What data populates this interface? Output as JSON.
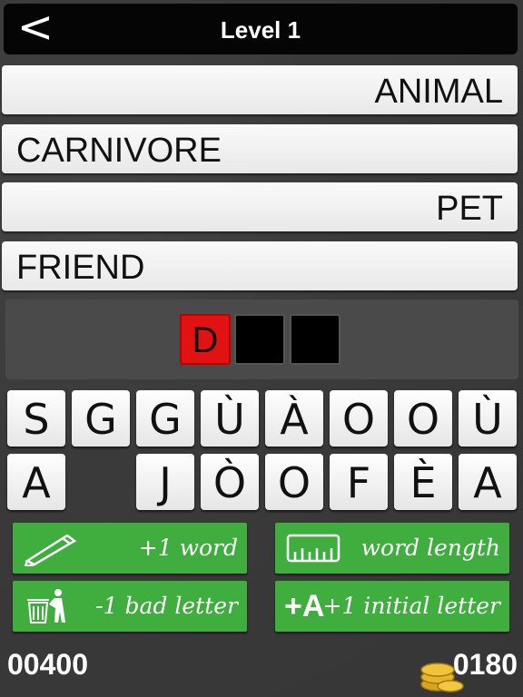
{
  "header": {
    "back_icon": "<",
    "title": "Level 1"
  },
  "clues": [
    "ANIMAL",
    "CARNIVORE",
    "PET",
    "FRIEND"
  ],
  "answer": {
    "slots": [
      "D",
      "",
      ""
    ]
  },
  "letters": {
    "row1": [
      "S",
      "G",
      "G",
      "Ù",
      "À",
      "O",
      "O",
      "Ù"
    ],
    "row2": [
      "A",
      "",
      "J",
      "Ò",
      "O",
      "F",
      "È",
      "A"
    ]
  },
  "helpers": {
    "plus_word": "+1 word",
    "word_length": "word length",
    "bad_letter": "-1 bad letter",
    "initial_letter": "+1 initial letter",
    "initial_icon_text": "+A"
  },
  "footer": {
    "score": "00400",
    "coins": "0180"
  },
  "colors": {
    "green": "#3fae3f",
    "red": "#e31212"
  }
}
